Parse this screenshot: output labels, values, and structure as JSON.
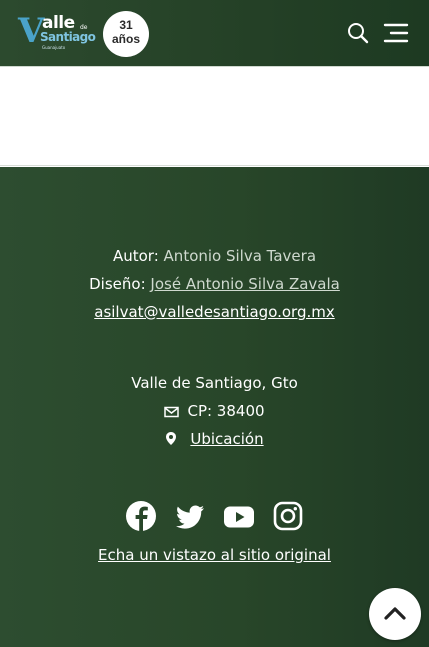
{
  "header": {
    "logo": {
      "v": "V",
      "alle": "alle",
      "de": "de",
      "santiago": "Santiago",
      "state": "Guanajuato"
    },
    "anniversary": {
      "number": "31",
      "label": "años"
    },
    "icons": {
      "search": "search-icon",
      "menu": "menu-icon"
    }
  },
  "footer": {
    "author_label": "Autor:",
    "author_name": "Antonio Silva Tavera",
    "design_label": "Diseño:",
    "design_name": "José Antonio Silva Zavala",
    "email": "asilvat@valledesantiago.org.mx",
    "city": "Valle de Santiago, Gto",
    "postal": "CP: 38400",
    "location": "Ubicación",
    "social": [
      "facebook-icon",
      "twitter-icon",
      "youtube-icon",
      "instagram-icon"
    ],
    "original_site": "Echa un vistazo al sitio original"
  },
  "colors": {
    "header_bg": "#2c4a2e",
    "footer_bg": "#284629",
    "logo_blue": "#4aa3c9",
    "muted_text": "#cfd9cf"
  }
}
